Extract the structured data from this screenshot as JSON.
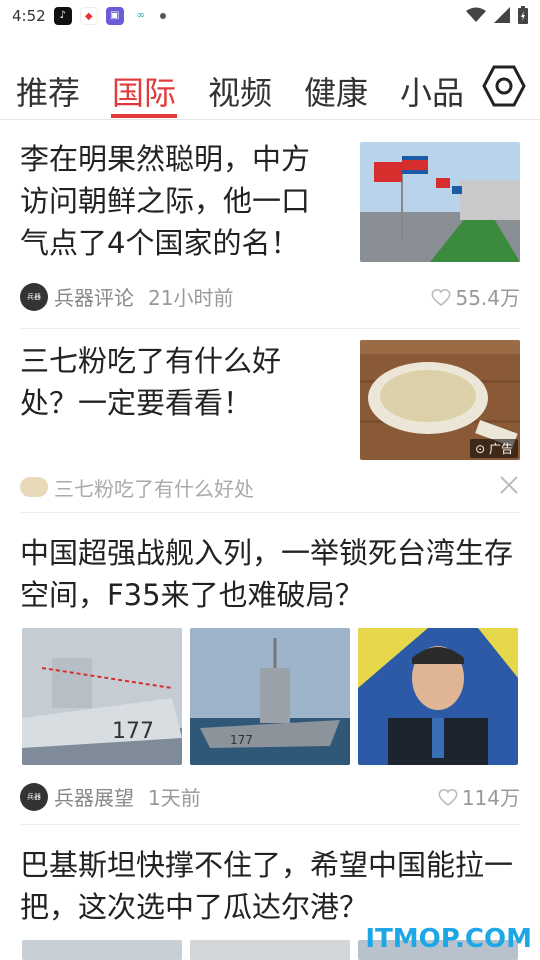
{
  "status": {
    "time": "4:52"
  },
  "tabs": [
    {
      "label": "推荐"
    },
    {
      "label": "国际"
    },
    {
      "label": "视频"
    },
    {
      "label": "健康"
    },
    {
      "label": "小品"
    }
  ],
  "articles": [
    {
      "title": "李在明果然聪明，中方访问朝鲜之际，他一口气点了4个国家的名！",
      "source": "兵器评论",
      "time": "21小时前",
      "likes": "55.4万"
    },
    {
      "title": "三七粉吃了有什么好处？一定要看看！",
      "ad_label": "广告",
      "ad_text": "三七粉吃了有什么好处"
    },
    {
      "title": "中国超强战舰入列，一举锁死台湾生存空间，F35来了也难破局？",
      "source": "兵器展望",
      "time": "1天前",
      "likes": "114万"
    },
    {
      "title": "巴基斯坦快撑不住了，希望中国能拉一把，这次选中了瓜达尔港？"
    }
  ],
  "watermark": "ITMOP.COM",
  "colors": {
    "accent": "#e23b3b"
  }
}
